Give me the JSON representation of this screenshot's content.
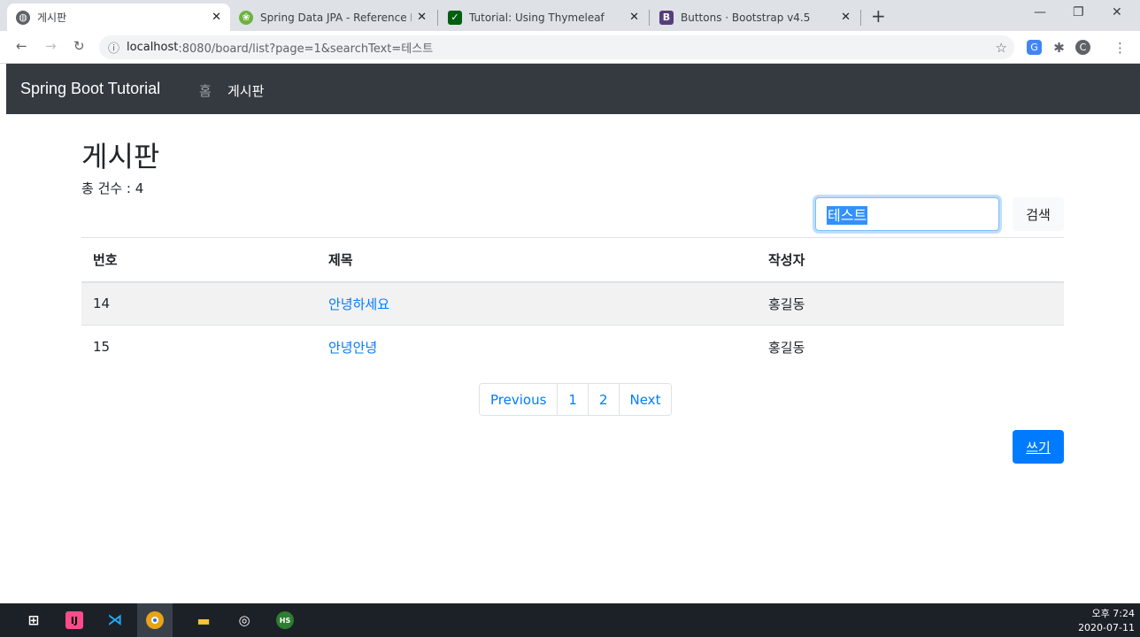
{
  "browser": {
    "tabs": [
      {
        "title": "게시판",
        "icon": "globe-icon",
        "active": true
      },
      {
        "title": "Spring Data JPA - Reference Do",
        "icon": "spring-icon",
        "active": false
      },
      {
        "title": "Tutorial: Using Thymeleaf",
        "icon": "thymeleaf-icon",
        "active": false
      },
      {
        "title": "Buttons · Bootstrap v4.5",
        "icon": "bootstrap-icon",
        "active": false
      }
    ],
    "close_glyph": "✕",
    "new_tab": "+",
    "window_controls": {
      "minimize": "—",
      "restore": "❐",
      "close": "✕"
    },
    "url_host": "localhost",
    "url_rest": ":8080/board/list?page=1&searchText=테스트",
    "profile_initial": "C"
  },
  "navbar": {
    "brand": "Spring Boot Tutorial",
    "links": [
      {
        "label": "홈",
        "active": false
      },
      {
        "label": "게시판",
        "active": true
      }
    ]
  },
  "page": {
    "title": "게시판",
    "total_label": "총 건수 : 4",
    "search_value": "테스트",
    "search_button": "검색",
    "write_button": "쓰기"
  },
  "table": {
    "headers": [
      "번호",
      "제목",
      "작성자"
    ],
    "rows": [
      {
        "id": "14",
        "title": "안녕하세요",
        "author": "홍길동"
      },
      {
        "id": "15",
        "title": "안녕안녕",
        "author": "홍길동"
      }
    ]
  },
  "pagination": {
    "previous": "Previous",
    "pages": [
      "1",
      "2"
    ],
    "next": "Next"
  },
  "taskbar": {
    "time": "오후 7:24",
    "date": "2020-07-11"
  },
  "colors": {
    "navbar_bg": "#343a40",
    "link": "#007bff",
    "primary_button": "#007bff"
  }
}
